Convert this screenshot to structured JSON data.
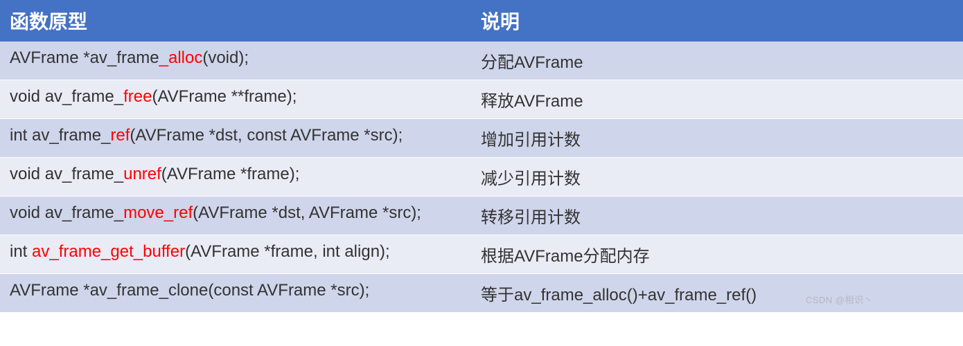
{
  "headers": {
    "prototype": "函数原型",
    "description": "说明"
  },
  "rows": [
    {
      "proto_segments": [
        {
          "text": "AVFrame *av_frame",
          "highlight": false
        },
        {
          "text": "_alloc",
          "highlight": true
        },
        {
          "text": "(void);",
          "highlight": false
        }
      ],
      "description": "分配AVFrame"
    },
    {
      "proto_segments": [
        {
          "text": "void av_frame_",
          "highlight": false
        },
        {
          "text": "free",
          "highlight": true
        },
        {
          "text": "(AVFrame **frame);",
          "highlight": false
        }
      ],
      "description": "释放AVFrame"
    },
    {
      "proto_segments": [
        {
          "text": "int av_frame_",
          "highlight": false
        },
        {
          "text": "ref",
          "highlight": true
        },
        {
          "text": "(AVFrame *dst, const AVFrame *src);",
          "highlight": false
        }
      ],
      "description": "增加引用计数"
    },
    {
      "proto_segments": [
        {
          "text": "void av_frame_",
          "highlight": false
        },
        {
          "text": "unref",
          "highlight": true
        },
        {
          "text": "(AVFrame *frame);",
          "highlight": false
        }
      ],
      "description": "减少引用计数"
    },
    {
      "proto_segments": [
        {
          "text": "void av_frame_",
          "highlight": false
        },
        {
          "text": "move_ref",
          "highlight": true
        },
        {
          "text": "(AVFrame *dst, AVFrame *src);",
          "highlight": false
        }
      ],
      "description": "转移引用计数"
    },
    {
      "proto_segments": [
        {
          "text": "int ",
          "highlight": false
        },
        {
          "text": "av_frame_get_buffer",
          "highlight": true
        },
        {
          "text": "(AVFrame *frame, int align);",
          "highlight": false
        }
      ],
      "description": "根据AVFrame分配内存"
    },
    {
      "proto_segments": [
        {
          "text": "AVFrame *av_frame_clone(const AVFrame *src);",
          "highlight": false
        }
      ],
      "description": "等于av_frame_alloc()+av_frame_ref()"
    }
  ],
  "watermark": "CSDN @相识丶"
}
